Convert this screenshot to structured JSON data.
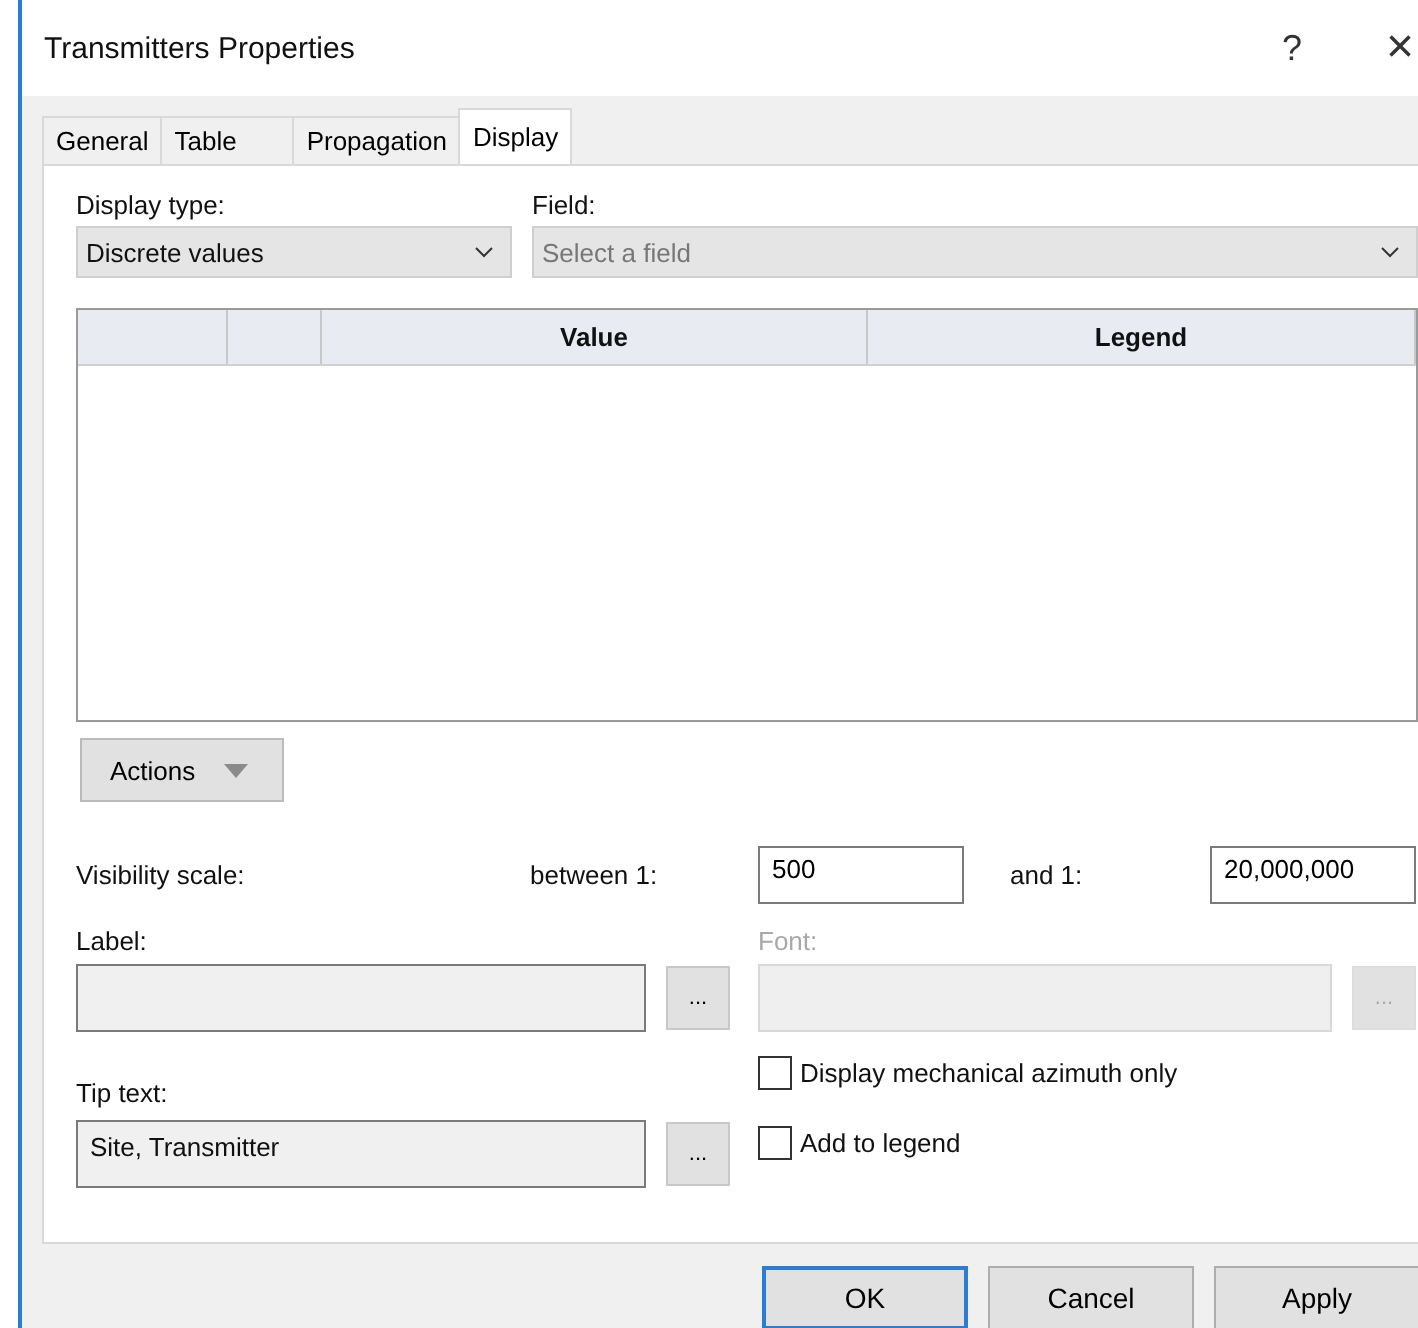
{
  "window": {
    "title": "Transmitters Properties",
    "help": "?",
    "close": "×"
  },
  "tabs": [
    {
      "label": "General",
      "selected": false
    },
    {
      "label": "Table",
      "selected": false
    },
    {
      "label": "Propagation",
      "selected": false
    },
    {
      "label": "Display",
      "selected": true
    }
  ],
  "display_type": {
    "label": "Display type:",
    "value": "Discrete values"
  },
  "field": {
    "label": "Field:",
    "placeholder": "Select a field"
  },
  "table": {
    "columns": [
      "",
      "",
      "Value",
      "Legend"
    ]
  },
  "actions_button": "Actions",
  "visibility": {
    "label": "Visibility scale:",
    "between_label": "between 1:",
    "between_value": "500",
    "and_label": "and 1:",
    "and_value": "20,000,000"
  },
  "label_field": {
    "label": "Label:",
    "button": "...",
    "disabled": false
  },
  "font_field": {
    "label": "Font:",
    "button": "...",
    "disabled": true
  },
  "tip_text": {
    "label": "Tip text:",
    "value": "Site, Transmitter",
    "button": "..."
  },
  "checkboxes": [
    {
      "label": "Display mechanical azimuth only",
      "checked": false
    },
    {
      "label": "Add to legend",
      "checked": false
    }
  ],
  "buttons": [
    {
      "label": "OK",
      "default": true
    },
    {
      "label": "Cancel",
      "default": false
    },
    {
      "label": "Apply",
      "default": false
    }
  ]
}
